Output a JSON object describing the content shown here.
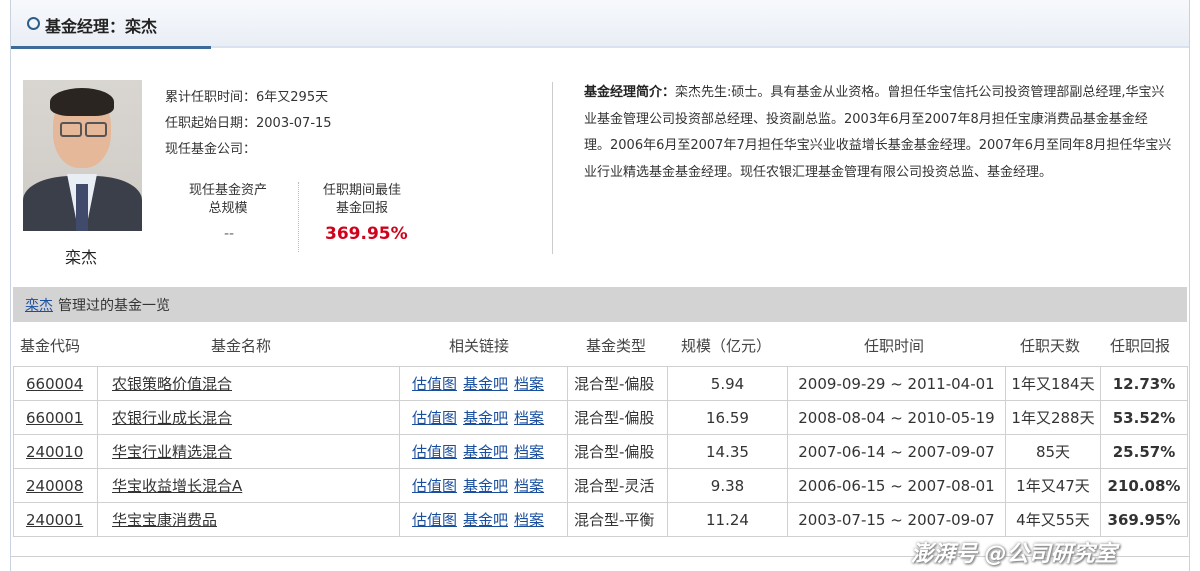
{
  "header": {
    "title": "基金经理：栾杰"
  },
  "manager": {
    "name": "栾杰",
    "tenure_total": "累计任职时间：6年又295天",
    "start_date": "任职起始日期：2003-07-15",
    "current_company": "现任基金公司：",
    "assets_label_line1": "现任基金资产",
    "assets_label_line2": "总规模",
    "assets_value": "--",
    "best_return_label_line1": "任职期间最佳",
    "best_return_label_line2": "基金回报",
    "best_return_value": "369.95%"
  },
  "bio": {
    "label": "基金经理简介：",
    "text": "栾杰先生:硕士。具有基金从业资格。曾担任华宝信托公司投资管理部副总经理,华宝兴业基金管理公司投资部总经理、投资副总监。2003年6月至2007年8月担任宝康消费品基金基金经理。2006年6月至2007年7月担任华宝兴业收益增长基金基金经理。2007年6月至同年8月担任华宝兴业行业精选基金基金经理。现任农银汇理基金管理有限公司投资总监、基金经理。"
  },
  "section": {
    "name_link": "栾杰",
    "title_suffix": "管理过的基金一览"
  },
  "table": {
    "headers": [
      "基金代码",
      "基金名称",
      "相关链接",
      "基金类型",
      "规模（亿元）",
      "任职时间",
      "任职天数",
      "任职回报"
    ],
    "link_labels": [
      "估值图",
      "基金吧",
      "档案"
    ],
    "rows": [
      {
        "code": "660004",
        "name": "农银策略价值混合",
        "type": "混合型-偏股",
        "scale": "5.94",
        "period": "2009-09-29 ~ 2011-04-01",
        "days": "1年又184天",
        "return": "12.73%"
      },
      {
        "code": "660001",
        "name": "农银行业成长混合",
        "type": "混合型-偏股",
        "scale": "16.59",
        "period": "2008-08-04 ~ 2010-05-19",
        "days": "1年又288天",
        "return": "53.52%"
      },
      {
        "code": "240010",
        "name": "华宝行业精选混合",
        "type": "混合型-偏股",
        "scale": "14.35",
        "period": "2007-06-14 ~ 2007-09-07",
        "days": "85天",
        "return": "25.57%"
      },
      {
        "code": "240008",
        "name": "华宝收益增长混合A",
        "type": "混合型-灵活",
        "scale": "9.38",
        "period": "2006-06-15 ~ 2007-08-01",
        "days": "1年又47天",
        "return": "210.08%"
      },
      {
        "code": "240001",
        "name": "华宝宝康消费品",
        "type": "混合型-平衡",
        "scale": "11.24",
        "period": "2003-07-15 ~ 2007-09-07",
        "days": "4年又55天",
        "return": "369.95%"
      }
    ]
  },
  "watermark": "澎湃号 @公司研究室"
}
